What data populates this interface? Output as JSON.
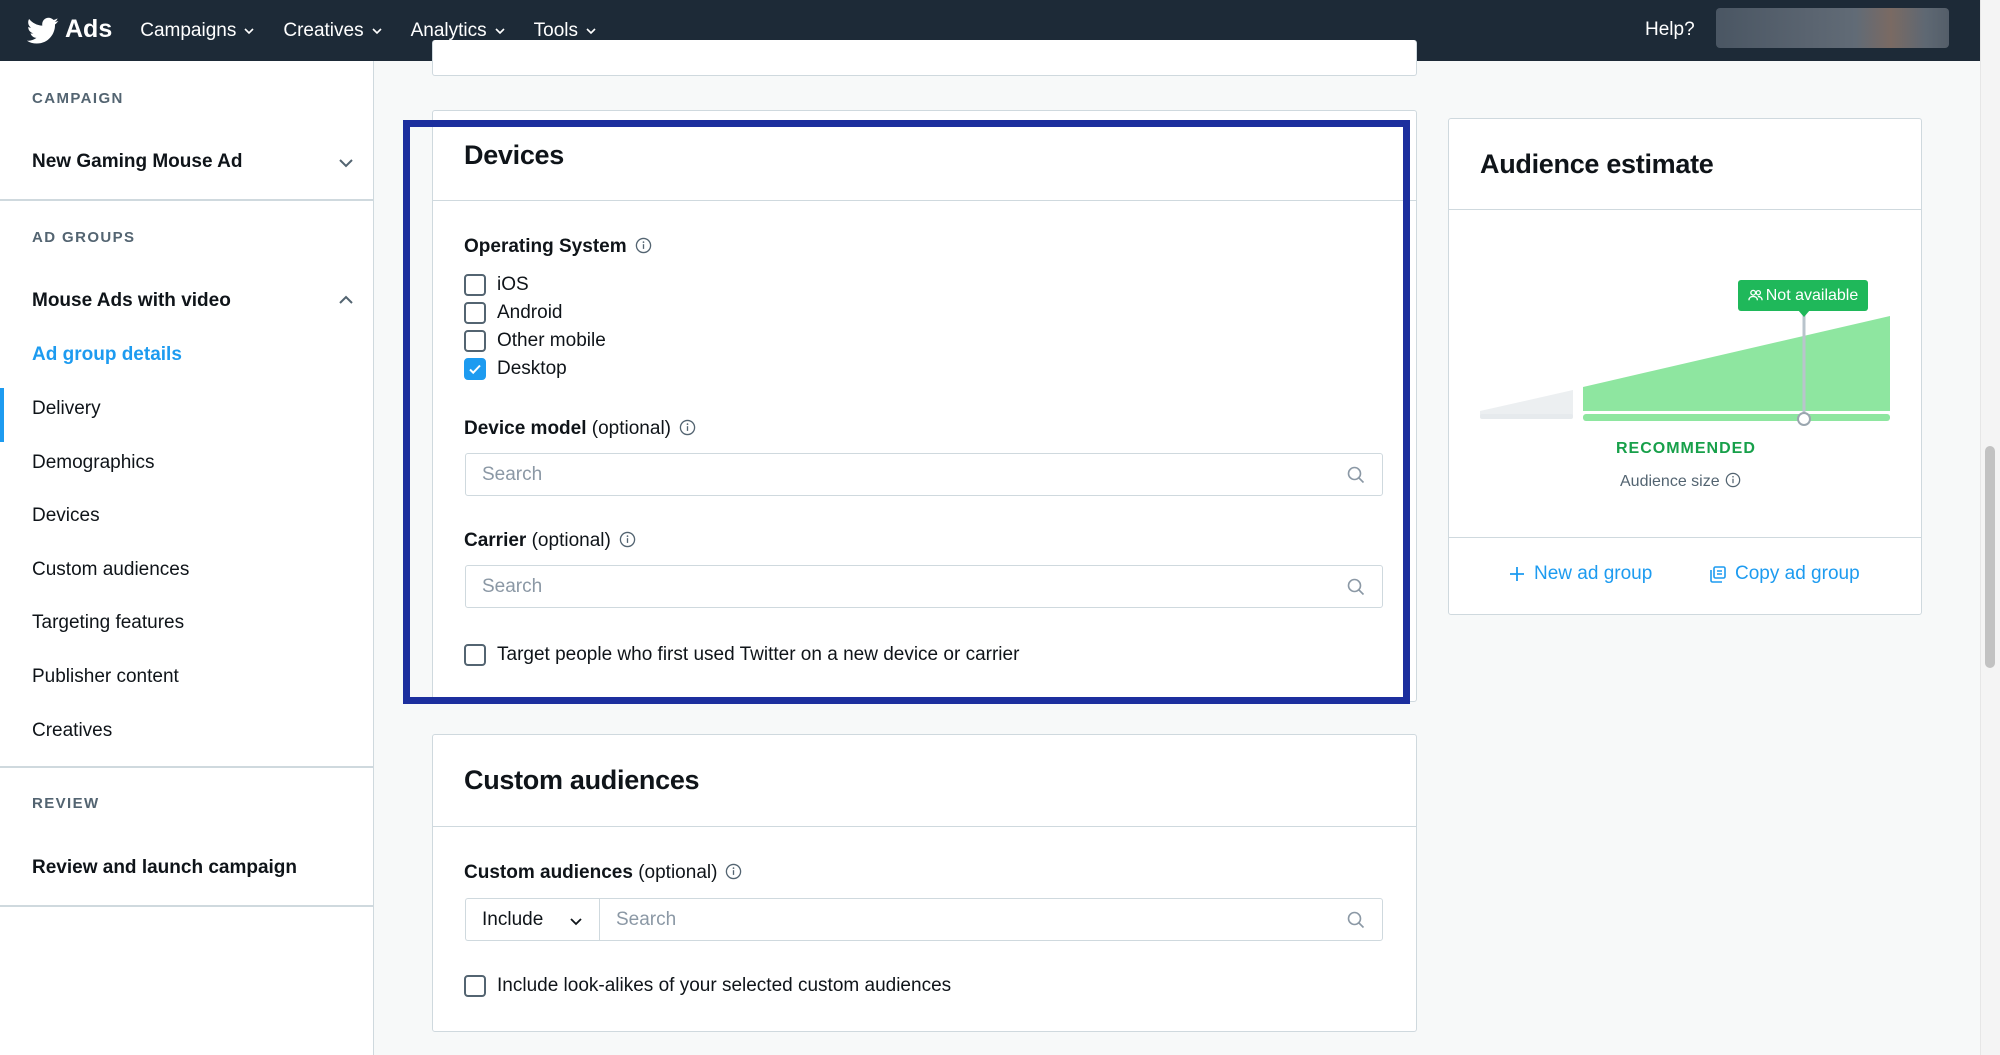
{
  "topnav": {
    "brand": "Ads",
    "menus": [
      "Campaigns",
      "Creatives",
      "Analytics",
      "Tools"
    ],
    "help": "Help?"
  },
  "sidebar": {
    "campaign_heading": "CAMPAIGN",
    "campaign_name": "New Gaming Mouse Ad",
    "adgroups_heading": "AD GROUPS",
    "adgroup_name": "Mouse Ads with video",
    "items": [
      "Ad group details",
      "Delivery",
      "Demographics",
      "Devices",
      "Custom audiences",
      "Targeting features",
      "Publisher content",
      "Creatives"
    ],
    "active_item": "Ad group details",
    "review_heading": "REVIEW",
    "review_item": "Review and launch campaign"
  },
  "devices": {
    "title": "Devices",
    "os_label": "Operating System",
    "os_options": [
      {
        "label": "iOS",
        "checked": false
      },
      {
        "label": "Android",
        "checked": false
      },
      {
        "label": "Other mobile",
        "checked": false
      },
      {
        "label": "Desktop",
        "checked": true
      }
    ],
    "device_model_label": "Device model",
    "device_model_optional": "(optional)",
    "device_model_placeholder": "Search",
    "carrier_label": "Carrier",
    "carrier_optional": "(optional)",
    "carrier_placeholder": "Search",
    "new_device_label": "Target people who first used Twitter on a new device or carrier",
    "new_device_checked": false
  },
  "custom_audiences": {
    "title": "Custom audiences",
    "field_label": "Custom audiences",
    "field_optional": "(optional)",
    "include_value": "Include",
    "search_placeholder": "Search",
    "lookalike_label": "Include look-alikes of your selected custom audiences",
    "lookalike_checked": false
  },
  "audience_estimate": {
    "title": "Audience estimate",
    "badge": "Not available",
    "recommended": "RECOMMENDED",
    "size_label": "Audience size",
    "new_ad_group": "New ad group",
    "copy_ad_group": "Copy ad group"
  },
  "colors": {
    "nav_bg": "#1d2a37",
    "accent": "#1d9bf0",
    "highlight_border": "#1c2f9e",
    "audience_green": "#8ee6a0",
    "badge_green": "#1fb85a"
  }
}
